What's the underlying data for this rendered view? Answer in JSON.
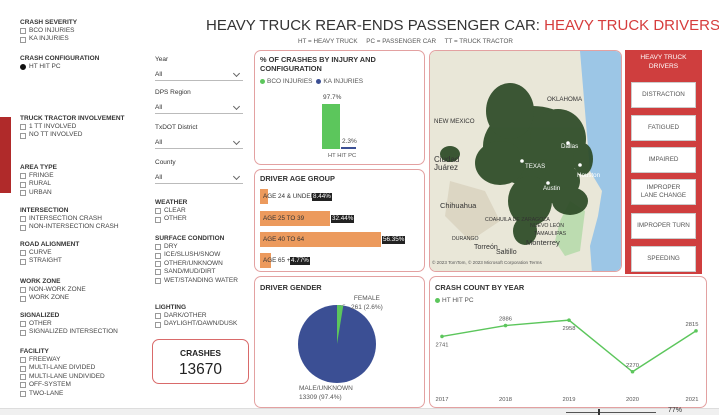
{
  "title": {
    "part1": "HEAVY TRUCK REAR-ENDS PASSENGER CAR: ",
    "part2": "HEAVY TRUCK DRIVERS",
    "subtitle": "HT = HEAVY TRUCK     PC = PASSENGER CAR     TT = TRUCK TRACTOR"
  },
  "filters_left": {
    "crash_severity": {
      "label": "CRASH SEVERITY",
      "options": [
        "BCO INJURIES",
        "KA INJURIES"
      ]
    },
    "crash_configuration": {
      "label": "CRASH CONFIGURATION",
      "selected": "HT HIT PC"
    },
    "truck_tractor": {
      "label": "TRUCK TRACTOR INVOLVEMENT",
      "options": [
        "1 TT INVOLVED",
        "NO TT INVOLVED"
      ]
    },
    "area_type": {
      "label": "AREA TYPE",
      "options": [
        "FRINGE",
        "RURAL",
        "URBAN"
      ]
    },
    "intersection": {
      "label": "INTERSECTION",
      "options": [
        "INTERSECTION CRASH",
        "NON-INTERSECTION CRASH"
      ]
    },
    "road_alignment": {
      "label": "ROAD ALIGNMENT",
      "options": [
        "CURVE",
        "STRAIGHT"
      ]
    },
    "work_zone": {
      "label": "WORK ZONE",
      "options": [
        "NON-WORK ZONE",
        "WORK ZONE"
      ]
    },
    "signalized": {
      "label": "SIGNALIZED",
      "options": [
        "OTHER",
        "SIGNALIZED INTERSECTION"
      ]
    },
    "facility": {
      "label": "FACILITY",
      "options": [
        "FREEWAY",
        "MULTI-LANE DIVIDED",
        "MULTI-LANE UNDIVIDED",
        "OFF-SYSTEM",
        "TWO-LANE"
      ]
    }
  },
  "filters_mid": {
    "year": {
      "label": "Year",
      "value": "All"
    },
    "dps_region": {
      "label": "DPS Region",
      "value": "All"
    },
    "txdot_district": {
      "label": "TxDOT District",
      "value": "All"
    },
    "county": {
      "label": "County",
      "value": "All"
    },
    "weather": {
      "label": "WEATHER",
      "options": [
        "CLEAR",
        "OTHER"
      ]
    },
    "surface": {
      "label": "SURFACE CONDITION",
      "options": [
        "DRY",
        "ICE/SLUSH/SNOW",
        "OTHER/UNKNOWN",
        "SAND/MUD/DIRT",
        "WET/STANDING WATER"
      ]
    },
    "lighting": {
      "label": "LIGHTING",
      "options": [
        "DARK/OTHER",
        "DAYLIGHT/DAWN/DUSK"
      ]
    }
  },
  "crashes": {
    "label": "CRASHES",
    "value": "13670"
  },
  "injury_chart": {
    "title_line1": "% OF CRASHES BY INJURY AND",
    "title_line2": "CONFIGURATION",
    "legend": [
      "BCO INJURIES",
      "KA INJURIES"
    ],
    "colors": {
      "bco": "#5cc65c",
      "ka": "#3b4f94"
    },
    "bco_label": "97.7%",
    "ka_label": "2.3%",
    "category": "HT HIT PC"
  },
  "age_chart": {
    "title": "DRIVER AGE GROUP",
    "groups": [
      {
        "label": "AGE 24 & UNDER",
        "pct": "8.44%"
      },
      {
        "label": "AGE 25 TO 39",
        "pct": "32.44%"
      },
      {
        "label": "AGE 40 TO 64",
        "pct": "56.35%"
      },
      {
        "label": "AGE 65 +",
        "pct": "4.77%"
      }
    ],
    "color": "#ec9a5d"
  },
  "gender_chart": {
    "title": "DRIVER GENDER",
    "female_label": "FEMALE",
    "female_value": "261 (2.6%)",
    "male_label": "MALE/UNKNOWN",
    "male_value": "13309 (97.4%)",
    "colors": {
      "male": "#3b4f94",
      "female": "#5cc65c"
    }
  },
  "year_chart": {
    "title": "CRASH COUNT BY YEAR",
    "legend": "HT HIT PC",
    "color": "#5cc65c"
  },
  "chart_data": {
    "type": "line",
    "title": "CRASH COUNT BY YEAR",
    "series": [
      {
        "name": "HT HIT PC",
        "values": [
          2741,
          2886,
          2958,
          2270,
          2815
        ]
      }
    ],
    "x": [
      "2017",
      "2018",
      "2019",
      "2020",
      "2021"
    ],
    "value_labels": [
      "2741",
      "2886",
      "2958",
      "2270",
      "2815"
    ],
    "ylim": [
      2200,
      3000
    ],
    "grid": false
  },
  "map": {
    "labels": [
      "OKLAHOMA",
      "NEW MEXICO",
      "Ciudad Juárez",
      "Dallas",
      "TEXAS",
      "Austin",
      "Houston",
      "Chihuahua",
      "COAHUILA DE ZARAGOZA",
      "DURANGO",
      "Torreón",
      "Saltillo",
      "Monterrey",
      "NUEVO LEÓN",
      "TAMAULIPAS"
    ],
    "footer": "© 2023 TomTom, © 2023 Microsoft Corporation  Terms"
  },
  "drivers_panel": {
    "title": "HEAVY TRUCK DRIVERS",
    "buttons": [
      "DISTRACTION",
      "FATIGUED",
      "IMPAIRED",
      "IMPROPER LANE CHANGE",
      "IMPROPER TURN",
      "SPEEDING"
    ]
  },
  "zoom": {
    "label": "77%"
  }
}
